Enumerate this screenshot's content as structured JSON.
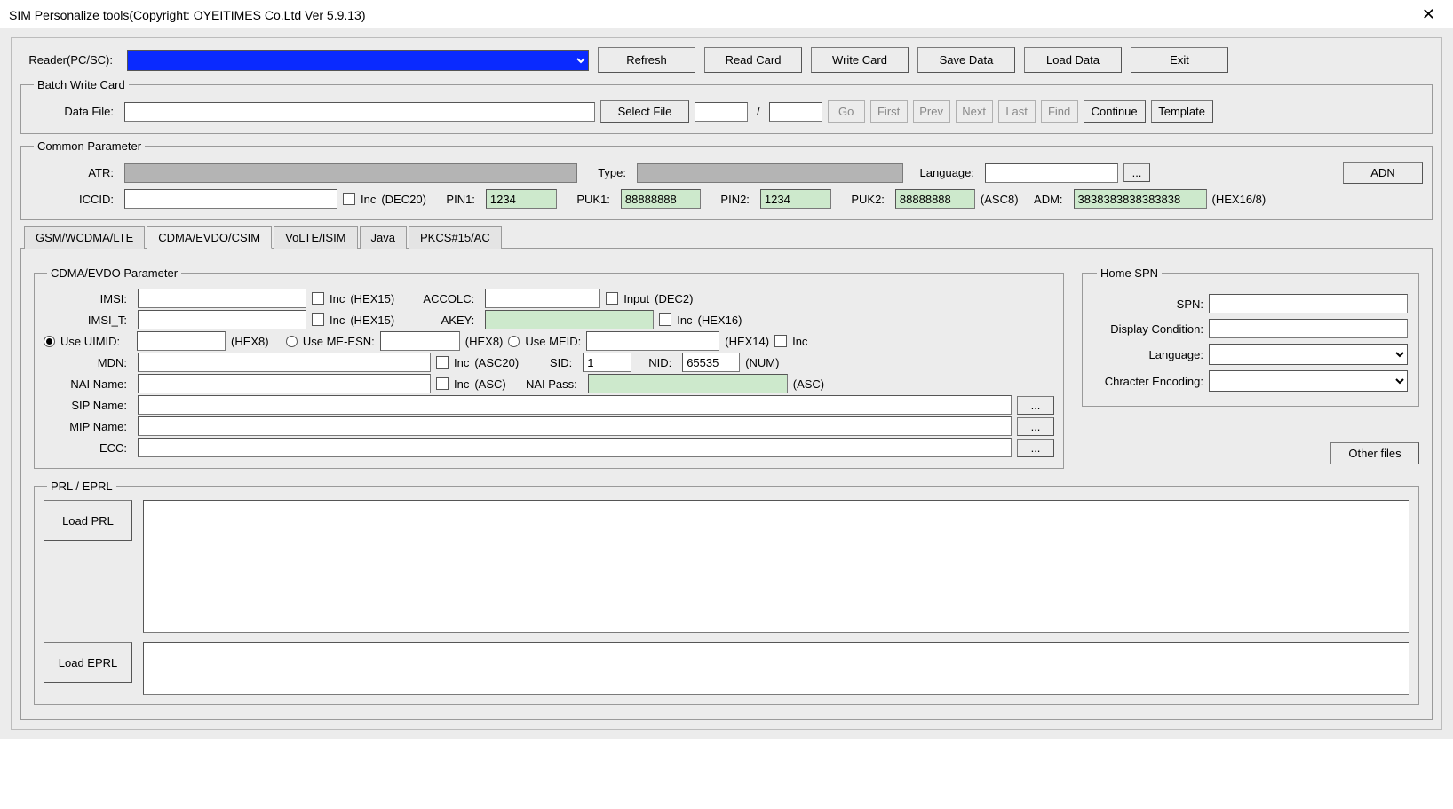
{
  "window": {
    "title": "SIM Personalize tools(Copyright: OYEITIMES Co.Ltd  Ver 5.9.13)"
  },
  "toolbar": {
    "reader_label": "Reader(PC/SC):",
    "refresh": "Refresh",
    "read_card": "Read Card",
    "write_card": "Write Card",
    "save_data": "Save Data",
    "load_data": "Load Data",
    "exit": "Exit"
  },
  "batch": {
    "legend": "Batch Write Card",
    "data_file_label": "Data File:",
    "select_file": "Select File",
    "slash": "/",
    "go": "Go",
    "first": "First",
    "prev": "Prev",
    "next": "Next",
    "last": "Last",
    "find": "Find",
    "continue": "Continue",
    "template": "Template"
  },
  "common": {
    "legend": "Common Parameter",
    "atr_label": "ATR:",
    "type_label": "Type:",
    "language_label": "Language:",
    "language_btn": "...",
    "adn": "ADN",
    "iccid_label": "ICCID:",
    "inc": "Inc",
    "dec20": "(DEC20)",
    "pin1_label": "PIN1:",
    "pin1_value": "1234",
    "puk1_label": "PUK1:",
    "puk1_value": "88888888",
    "pin2_label": "PIN2:",
    "pin2_value": "1234",
    "puk2_label": "PUK2:",
    "puk2_value": "88888888",
    "asc8": "(ASC8)",
    "adm_label": "ADM:",
    "adm_value": "3838383838383838",
    "hex168": "(HEX16/8)"
  },
  "tabs": {
    "t1": "GSM/WCDMA/LTE",
    "t2": "CDMA/EVDO/CSIM",
    "t3": "VoLTE/ISIM",
    "t4": "Java",
    "t5": "PKCS#15/AC"
  },
  "cdma": {
    "legend": "CDMA/EVDO Parameter",
    "imsi_label": "IMSI:",
    "inc": "Inc",
    "hex15": "(HEX15)",
    "accolc_label": "ACCOLC:",
    "input": "Input",
    "dec2": "(DEC2)",
    "imsi_t_label": "IMSI_T:",
    "akey_label": "AKEY:",
    "hex16": "(HEX16)",
    "use_uimid": "Use UIMID:",
    "hex8": "(HEX8)",
    "use_me_esn": "Use ME-ESN:",
    "use_meid": "Use MEID:",
    "hex14": "(HEX14)",
    "mdn_label": "MDN:",
    "asc20": "(ASC20)",
    "sid_label": "SID:",
    "sid_value": "1",
    "nid_label": "NID:",
    "nid_value": "65535",
    "num": "(NUM)",
    "nai_name_label": "NAI Name:",
    "asc": "(ASC)",
    "nai_pass_label": "NAI Pass:",
    "sip_name_label": "SIP Name:",
    "mip_name_label": "MIP Name:",
    "ecc_label": "ECC:",
    "dots": "...",
    "other_files": "Other files",
    "prl_legend": "PRL / EPRL",
    "load_prl": "Load PRL",
    "load_eprl": "Load EPRL"
  },
  "home_spn": {
    "legend": "Home SPN",
    "spn_label": "SPN:",
    "display_cond_label": "Display Condition:",
    "language_label": "Language:",
    "char_enc_label": "Chracter Encoding:"
  }
}
